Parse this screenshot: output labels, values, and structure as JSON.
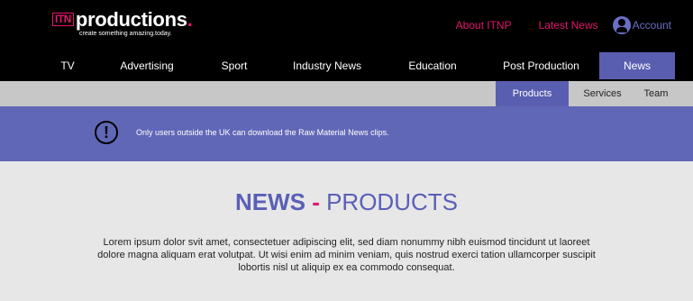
{
  "brand": {
    "mark": "ITN",
    "name": "productions",
    "dot": ".",
    "tagline": "create something amazing.today."
  },
  "utility_nav": {
    "about": "About ITNP",
    "latest": "Latest News",
    "account": "Account"
  },
  "main_nav": {
    "items": [
      "TV",
      "Advertising",
      "Sport",
      "Industry News",
      "Education",
      "Post Production",
      "News"
    ],
    "active": "News"
  },
  "sub_nav": {
    "items": [
      "Products",
      "Services",
      "Team"
    ],
    "active": "Products"
  },
  "alert": {
    "icon": "exclamation-circle-icon",
    "text": "Only users outside the UK can download the Raw Material News clips."
  },
  "page": {
    "headline_strong": "NEWS",
    "headline_dash": " - ",
    "headline_rest": "PRODUCTS",
    "body": "Lorem ipsum dolor svit amet, consectetuer adipiscing elit, sed diam nonummy nibh euismod tincidunt ut laoreet dolore magna aliquam erat volutpat. Ut wisi enim ad minim veniam, quis nostrud exerci tation ullamcorper suscipit lobortis nisl ut aliquip ex ea commodo consequat."
  },
  "colors": {
    "accent_pink": "#e2156b",
    "accent_purple": "#5a5eb0",
    "header_bg": "#000000",
    "subnav_bg": "#c7c7c7",
    "page_bg": "#e7e7e7"
  }
}
